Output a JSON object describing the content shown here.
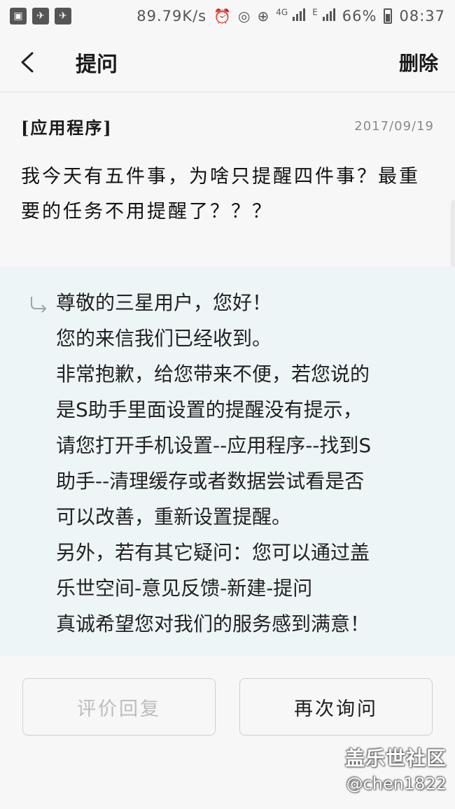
{
  "status_bar": {
    "network_speed": "89.79K/s",
    "network_type_1": "4G",
    "network_type_2": "E",
    "battery_percent": "66%",
    "time": "08:37"
  },
  "header": {
    "title": "提问",
    "delete_label": "删除"
  },
  "question": {
    "category": "[应用程序]",
    "date": "2017/09/19",
    "text": "我今天有五件事，为啥只提醒四件事？最重要的任务不用提醒了？？？"
  },
  "reply": {
    "lines": [
      "尊敬的三星用户，您好！",
      "您的来信我们已经收到。",
      "非常抱歉，给您带来不便，若您说的",
      "是S助手里面设置的提醒没有提示，",
      "请您打开手机设置--应用程序--找到S",
      "助手--清理缓存或者数据尝试看是否",
      "可以改善，重新设置提醒。",
      "另外，若有其它疑问：您可以通过盖",
      "乐世空间-意见反馈-新建-提问",
      "真诚希望您对我们的服务感到满意！"
    ]
  },
  "actions": {
    "rate_label": "评价回复",
    "ask_again_label": "再次询问"
  },
  "watermark": {
    "title": "盖乐世社区",
    "user": "@chen1822"
  },
  "colors": {
    "reply_background": "#eef5f7",
    "disabled_text": "#bdbdbd"
  }
}
